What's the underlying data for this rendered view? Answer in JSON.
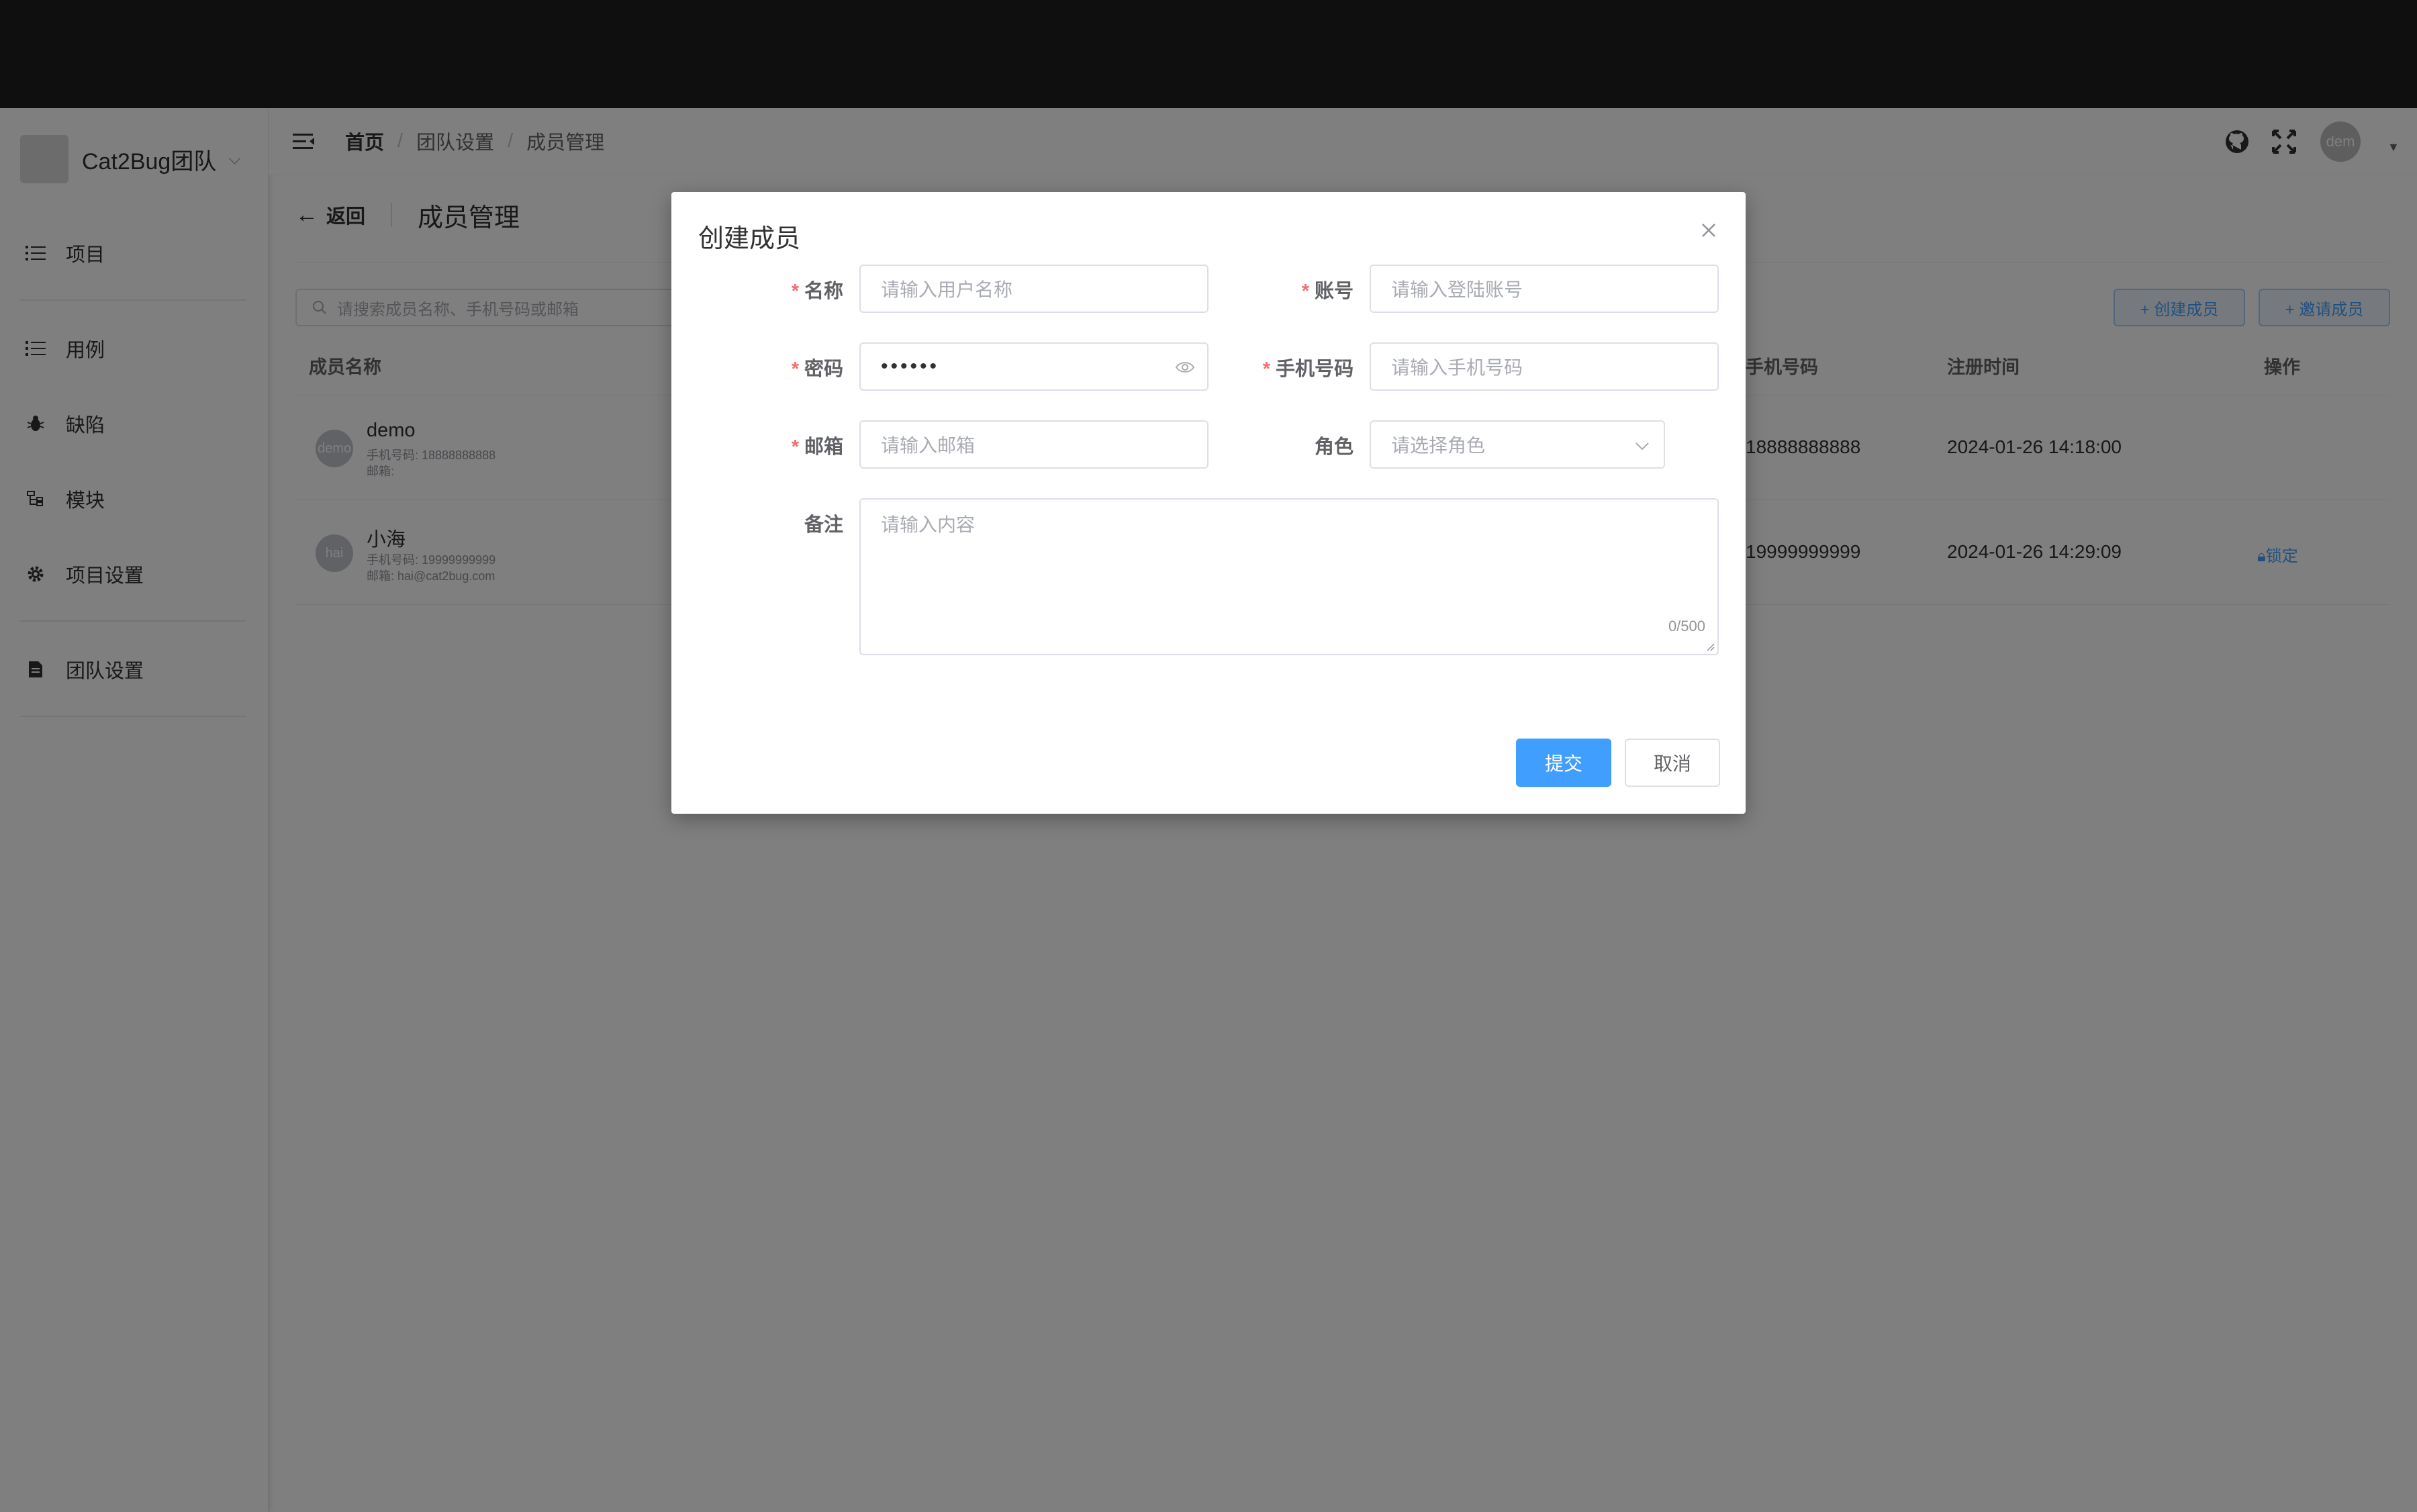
{
  "sidebar": {
    "team_name": "Cat2Bug团队",
    "items": [
      {
        "label": "项目",
        "icon": "list-icon"
      },
      {
        "label": "用例",
        "icon": "case-list-icon"
      },
      {
        "label": "缺陷",
        "icon": "bug-icon"
      },
      {
        "label": "模块",
        "icon": "module-tree-icon"
      },
      {
        "label": "项目设置",
        "icon": "gear-icon"
      },
      {
        "label": "团队设置",
        "icon": "team-doc-icon"
      }
    ]
  },
  "header": {
    "breadcrumb": [
      "首页",
      "团队设置",
      "成员管理"
    ],
    "avatar_text": "dem"
  },
  "page": {
    "back_label": "返回",
    "title": "成员管理",
    "search_placeholder": "请搜索成员名称、手机号码或邮箱",
    "create_member_label": "+ 创建成员",
    "invite_member_label": "+ 邀请成员"
  },
  "table": {
    "columns": {
      "name": "成员名称",
      "phone": "手机号码",
      "register_time": "注册时间",
      "actions": "操作"
    },
    "rows": [
      {
        "avatar": "demo",
        "name": "demo",
        "sub_phone": "手机号码: 18888888888",
        "sub_email": "邮箱:",
        "phone": "18888888888",
        "register_time": "2024-01-26 14:18:00",
        "action": ""
      },
      {
        "avatar": "hai",
        "name": "小海",
        "sub_phone": "手机号码: 19999999999",
        "sub_email": "邮箱: hai@cat2bug.com",
        "phone": "19999999999",
        "register_time": "2024-01-26 14:29:09",
        "action": "锁定"
      }
    ]
  },
  "dialog": {
    "title": "创建成员",
    "fields": {
      "name": {
        "label": "名称",
        "placeholder": "请输入用户名称"
      },
      "account": {
        "label": "账号",
        "placeholder": "请输入登陆账号"
      },
      "password": {
        "label": "密码",
        "value": "••••••"
      },
      "phone": {
        "label": "手机号码",
        "placeholder": "请输入手机号码"
      },
      "email": {
        "label": "邮箱",
        "placeholder": "请输入邮箱"
      },
      "role": {
        "label": "角色",
        "placeholder": "请选择角色"
      },
      "remark": {
        "label": "备注",
        "placeholder": "请输入内容",
        "counter": "0/500"
      }
    },
    "submit_label": "提交",
    "cancel_label": "取消"
  },
  "colors": {
    "primary": "#409eff",
    "required": "#f56c6c",
    "topbar": "#1f1f1f"
  }
}
